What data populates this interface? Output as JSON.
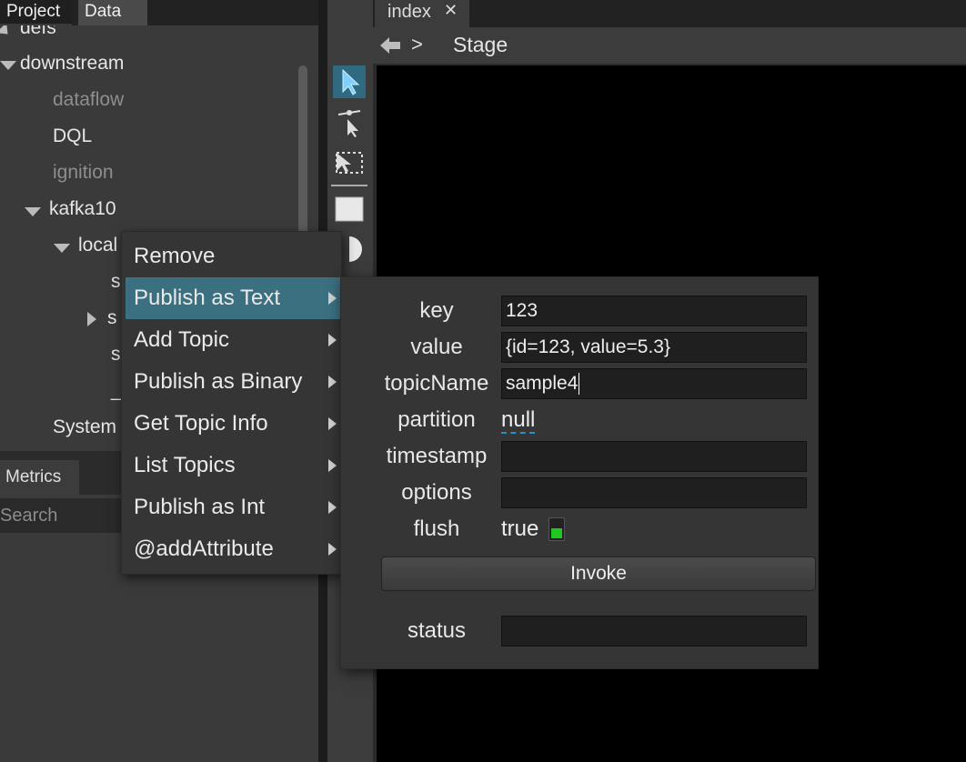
{
  "left_panel": {
    "tabs": [
      "Project",
      "Data"
    ],
    "tree": {
      "defs": "defs",
      "downstream": "downstream",
      "dataflow": "dataflow",
      "dql": "DQL",
      "ignition": "ignition",
      "kafka10": "kafka10",
      "local": "local",
      "child1": "s",
      "child2": "s",
      "child3": "s",
      "child4": "_",
      "system": "System"
    },
    "metrics_tab": "Metrics",
    "search_placeholder": "Search"
  },
  "editor": {
    "tab_label": "index",
    "tab_close": "✕",
    "breadcrumb_sep": ">",
    "breadcrumb_current": "Stage"
  },
  "context_menu": {
    "items": [
      {
        "label": "Remove"
      },
      {
        "label": "Publish as Text"
      },
      {
        "label": "Add Topic"
      },
      {
        "label": "Publish as Binary"
      },
      {
        "label": "Get Topic Info"
      },
      {
        "label": "List Topics"
      },
      {
        "label": "Publish as Int"
      },
      {
        "label": "@addAttribute"
      }
    ]
  },
  "action_form": {
    "key_label": "key",
    "key_value": "123",
    "value_label": "value",
    "value_value": "{id=123, value=5.3}",
    "topicName_label": "topicName",
    "topicName_value": "sample4",
    "partition_label": "partition",
    "partition_value": "null",
    "timestamp_label": "timestamp",
    "timestamp_value": "",
    "options_label": "options",
    "options_value": "",
    "flush_label": "flush",
    "flush_value": "true",
    "invoke_label": "Invoke",
    "status_label": "status",
    "status_value": ""
  },
  "colors": {
    "menu_highlight": "#3b7080",
    "toolbar_active": "#2f6a80",
    "toggle_on": "#1ec81e"
  },
  "icons": [
    "select-arrow-icon",
    "pivot-select-icon",
    "marquee-select-icon",
    "rectangle-icon",
    "half-circle-icon",
    "back-arrow-icon"
  ]
}
